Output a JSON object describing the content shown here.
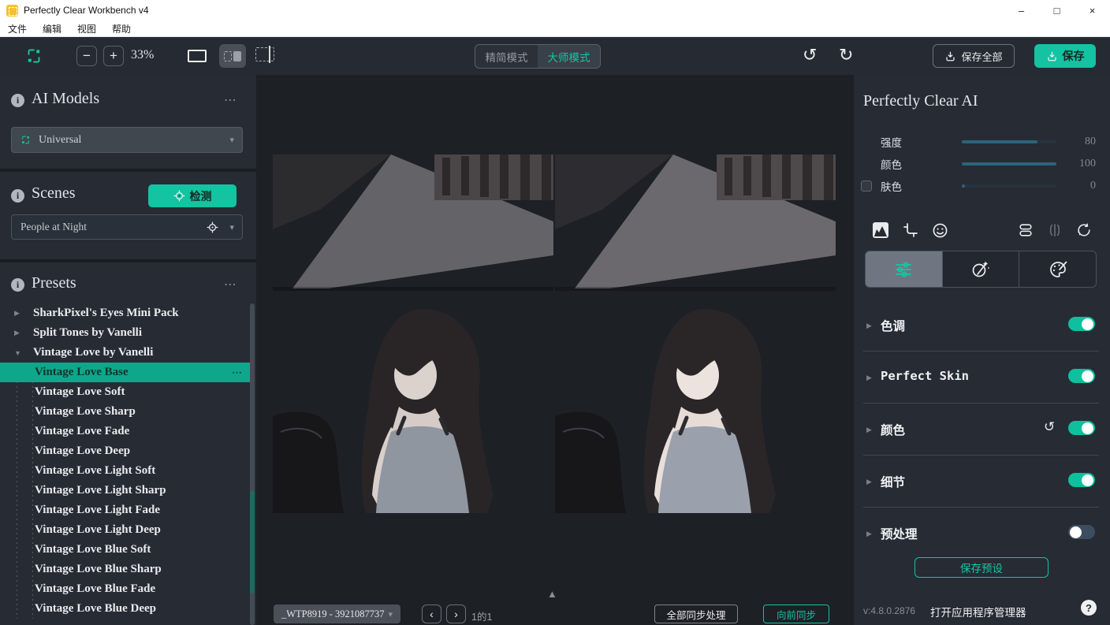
{
  "window": {
    "title": "Perfectly Clear Workbench v4",
    "minimize": "–",
    "maximize": "□",
    "close": "×"
  },
  "menu": {
    "items": [
      "文件",
      "编辑",
      "视图",
      "帮助"
    ]
  },
  "toolbar": {
    "zoom_out": "−",
    "zoom_in": "+",
    "zoom_level": "33%",
    "mode_simple": "精简模式",
    "mode_master": "大师模式",
    "undo": "↺",
    "redo": "↻",
    "save_all": "保存全部",
    "save": "保存"
  },
  "sidebar": {
    "ai_models": {
      "info": "i",
      "title": "AI Models",
      "menu": "⋯",
      "selected": "Universal",
      "caret": "▾"
    },
    "scenes": {
      "info": "i",
      "title": "Scenes",
      "detect": "检测",
      "selected": "People at Night",
      "caret": "▾"
    },
    "presets": {
      "info": "i",
      "title": "Presets",
      "menu": "⋯",
      "groups": [
        {
          "arrow": "▶",
          "label": "SharkPixel's Eyes Mini Pack"
        },
        {
          "arrow": "▶",
          "label": "Split Tones by Vanelli"
        },
        {
          "arrow": "▼",
          "label": "Vintage Love by Vanelli"
        }
      ],
      "selected_item": {
        "label": "Vintage Love Base",
        "menu": "⋯"
      },
      "items": [
        "Vintage Love Soft",
        "Vintage Love Sharp",
        "Vintage Love Fade",
        "Vintage Love Deep",
        "Vintage Love Light Soft",
        "Vintage Love Light Sharp",
        "Vintage Love Light Fade",
        "Vintage Love Light Deep",
        "Vintage Love Blue Soft",
        "Vintage Love Blue Sharp",
        "Vintage Love Blue Fade",
        "Vintage Love Blue Deep"
      ]
    }
  },
  "viewer": {
    "expand": "▲"
  },
  "filmstrip": {
    "filename": "_WTP8919 - 3921087737",
    "caret": "▾",
    "prev": "‹",
    "next": "›",
    "counter": "1的1",
    "sync_all": "全部同步处理",
    "sync_forward": "向前同步"
  },
  "panel": {
    "title": "Perfectly Clear AI",
    "sliders": [
      {
        "label": "强度",
        "value": 80,
        "max": 100
      },
      {
        "label": "颜色",
        "value": 100,
        "max": 100
      },
      {
        "label": "肤色",
        "value": 0,
        "max": 100,
        "checkbox_checked": false
      }
    ],
    "sections": [
      {
        "arrow": "▶",
        "label": "色调",
        "enabled": true
      },
      {
        "arrow": "▶",
        "label": "Perfect Skin",
        "enabled": true
      },
      {
        "arrow": "▶",
        "label": "颜色",
        "enabled": true,
        "reset": "↺"
      },
      {
        "arrow": "▶",
        "label": "细节",
        "enabled": true
      },
      {
        "arrow": "▶",
        "label": "预处理",
        "enabled": false
      }
    ],
    "save_preset": "保存预设",
    "version": "v:4.8.0.2876",
    "app_manager": "打开应用程序管理器",
    "help": "?"
  },
  "colors": {
    "accent": "#13c3a2",
    "selection": "#0fa78b",
    "slider_fill": "#2e637c",
    "panel_bg": "#262b34",
    "canvas_bg": "#1d2025"
  }
}
